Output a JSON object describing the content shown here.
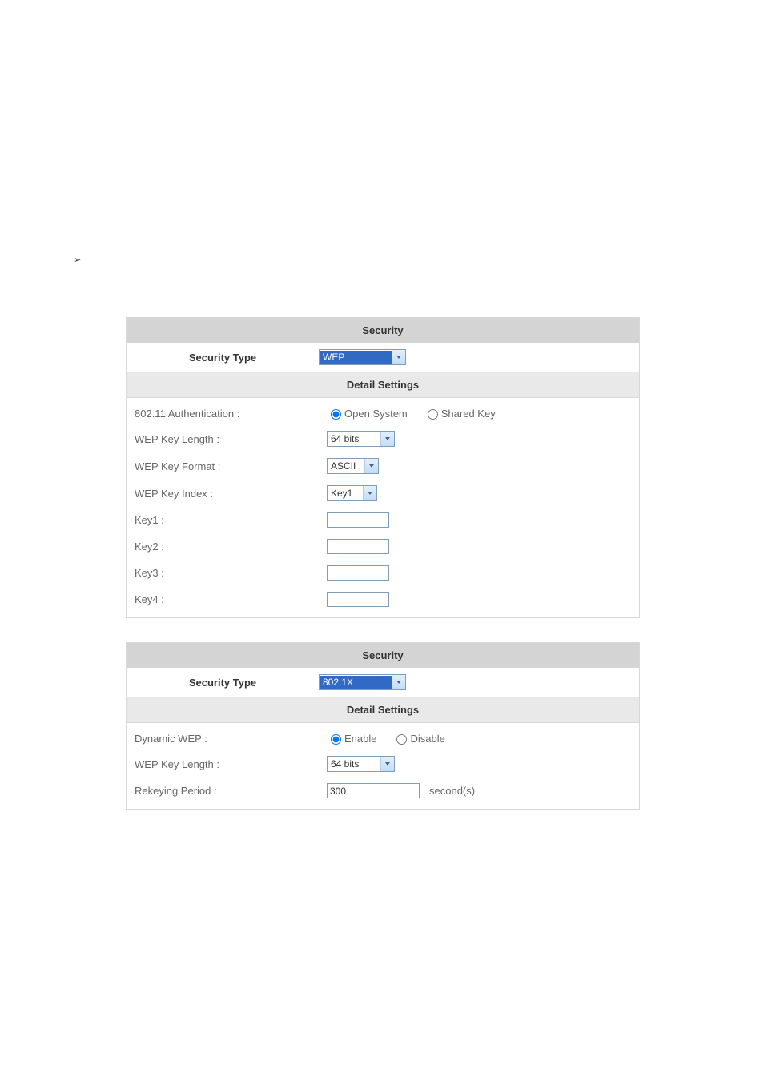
{
  "panel1": {
    "security_header": "Security",
    "security_type_label": "Security Type",
    "security_type_value": "WEP",
    "detail_header": "Detail Settings",
    "auth_label": "802.11 Authentication :",
    "auth_open": "Open System",
    "auth_shared": "Shared Key",
    "wep_key_length_label": "WEP Key Length :",
    "wep_key_length_value": "64 bits",
    "wep_key_format_label": "WEP Key Format :",
    "wep_key_format_value": "ASCII",
    "wep_key_index_label": "WEP Key Index :",
    "wep_key_index_value": "Key1",
    "key1_label": "Key1 :",
    "key2_label": "Key2 :",
    "key3_label": "Key3 :",
    "key4_label": "Key4 :"
  },
  "panel2": {
    "security_header": "Security",
    "security_type_label": "Security Type",
    "security_type_value": "802.1X",
    "detail_header": "Detail Settings",
    "dynamic_wep_label": "Dynamic WEP :",
    "enable_label": "Enable",
    "disable_label": "Disable",
    "wep_key_length_label": "WEP Key Length :",
    "wep_key_length_value": "64 bits",
    "rekeying_label": "Rekeying Period :",
    "rekeying_value": "300",
    "rekeying_unit": "second(s)"
  }
}
